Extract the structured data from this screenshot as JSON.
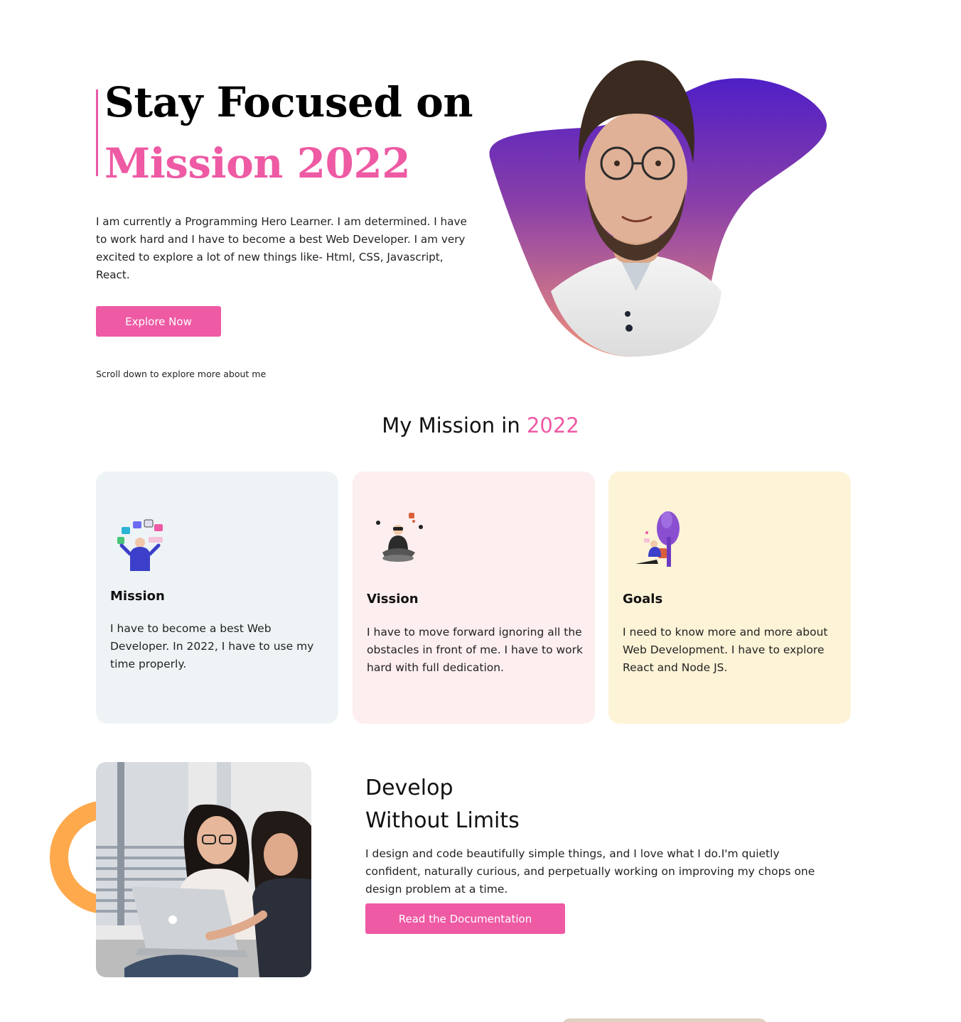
{
  "hero": {
    "title_line1": "Stay Focused on",
    "title_line2": "Mission 2022",
    "description": "I am currently a Programming Hero Learner. I am determined. I have to work hard and I have to become a best Web Developer. I am very excited to explore a lot of new things like- Html, CSS, Javascript, React.",
    "cta_label": "Explore Now",
    "scroll_note": "Scroll down to explore more about me"
  },
  "mission_section": {
    "title_prefix": "My Mission in",
    "title_accent": "2022"
  },
  "cards": [
    {
      "title": "Mission",
      "text": "I have to become a best Web Developer. In 2022, I have to use my time properly.",
      "icon": "juggling-apps-illustration"
    },
    {
      "title": "Vission",
      "text": "I have to move forward ignoring all the obstacles in front of me. I have to work hard with full dedication.",
      "icon": "vr-meditation-illustration"
    },
    {
      "title": "Goals",
      "text": "I need to know more and more about Web Development. I have to explore React and Node JS.",
      "icon": "reading-under-tree-illustration"
    }
  ],
  "develop": {
    "title_line1": "Develop",
    "title_line2": "Without Limits",
    "description": "I design and code beautifully simple things, and I love what I do.I'm quietly confident, naturally curious, and perpetually working on improving my chops one design problem at a time.",
    "cta_label": "Read the Documentation"
  },
  "colors": {
    "accent_pink": "#ee5aa4",
    "card_mission": "#eef4f6",
    "card_vision": "#fdeeef",
    "card_goals": "#fdf3d7",
    "ring_orange": "#ffa94d",
    "blob_top": "#4f1fc6",
    "blob_bottom": "#e8877a"
  }
}
